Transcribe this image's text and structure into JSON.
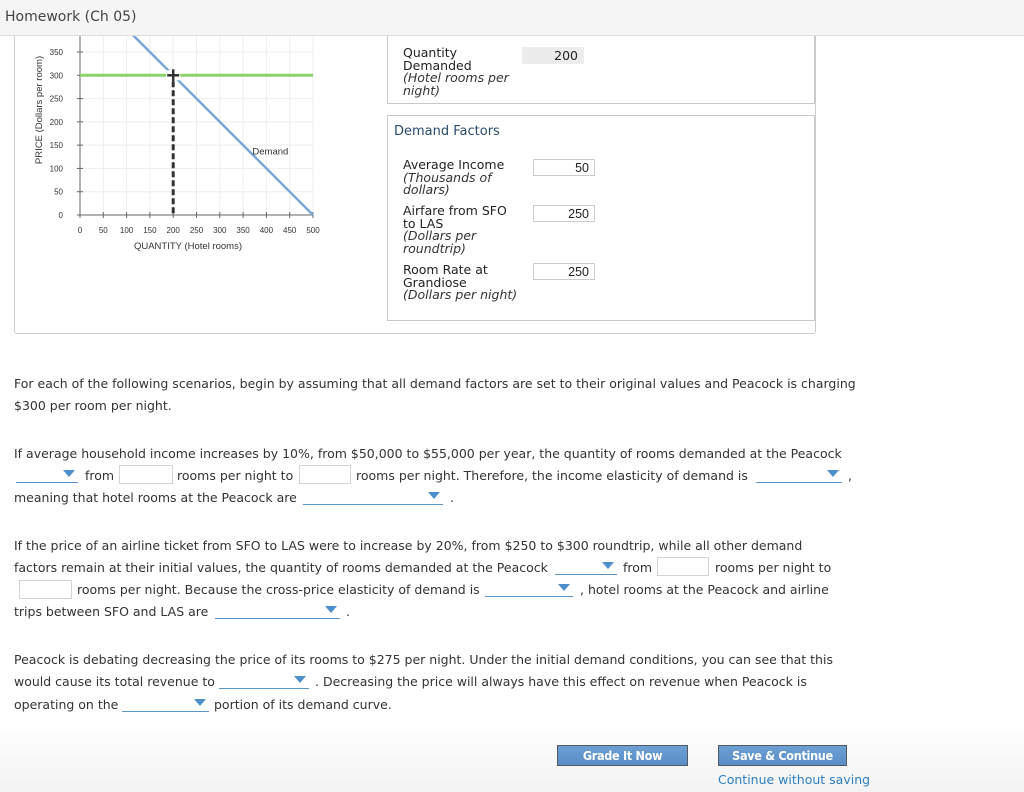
{
  "header": {
    "title": "Homework (Ch 05)"
  },
  "chart_data": {
    "type": "line",
    "title": "",
    "xlabel": "QUANTITY (Hotel rooms)",
    "ylabel": "PRICE (Dollars per room)",
    "xlim": [
      0,
      500
    ],
    "ylim": [
      0,
      350
    ],
    "x_ticks": [
      0,
      50,
      100,
      150,
      200,
      250,
      300,
      350,
      400,
      450,
      500
    ],
    "y_ticks": [
      0,
      50,
      100,
      150,
      200,
      250,
      300,
      350
    ],
    "grid": true,
    "series": [
      {
        "name": "Demand",
        "color": "#7ba7d6",
        "points": [
          [
            0,
            500
          ],
          [
            500,
            0
          ]
        ],
        "label": "Demand"
      },
      {
        "name": "Price",
        "color": "#88d46a",
        "points": [
          [
            0,
            300
          ],
          [
            500,
            300
          ]
        ]
      }
    ],
    "marker": {
      "name": "crosshair",
      "x": 200,
      "y": 300,
      "color": "#333333"
    },
    "dropline": {
      "x": 200,
      "from_y": 0,
      "to_y": 300,
      "style": "dashed"
    }
  },
  "quantity_box": {
    "label": "Quantity Demanded",
    "unit": "(Hotel rooms per night)",
    "value": "200"
  },
  "demand_factors": {
    "title": "Demand Factors",
    "items": [
      {
        "label": "Average Income",
        "unit": "(Thousands of dollars)",
        "value": "50"
      },
      {
        "label": "Airfare from SFO to LAS",
        "unit": "(Dollars per roundtrip)",
        "value": "250"
      },
      {
        "label": "Room Rate at Grandiose",
        "unit": "(Dollars per night)",
        "value": "250"
      }
    ]
  },
  "intro": {
    "line1": "For each of the following scenarios, begin by assuming that all demand factors are set to their original values and Peacock is charging",
    "line2": "$300 per room per night."
  },
  "q1": {
    "line1": "If average household income increases by 10%, from $50,000 to $55,000 per year, the quantity of rooms demanded at the Peacock",
    "from": "from",
    "mid": "rooms per night to",
    "after": "rooms per night. Therefore, the income elasticity of demand is",
    "comma": ",",
    "line3": "meaning that hotel rooms at the Peacock are",
    "period": "."
  },
  "q2": {
    "line1": "If the price of an airline ticket from SFO to LAS were to increase by 20%, from $250 to $300 roundtrip, while all other demand",
    "line2a": "factors remain at their initial values, the quantity of rooms demanded at the Peacock",
    "from": "from",
    "line2b": "rooms per night to",
    "line3a": "rooms per night. Because the cross-price elasticity of demand is",
    "line3b": ", hotel rooms at the Peacock and airline",
    "line4": "trips between SFO and LAS are",
    "period": "."
  },
  "q3": {
    "line1": "Peacock is debating decreasing the price of its rooms to $275 per night. Under the initial demand conditions, you can see that this",
    "line2a": "would cause its total revenue to",
    "line2b": ". Decreasing the price will always have this effect on revenue when Peacock is",
    "line3a": "operating on the",
    "line3b": "portion of its demand curve."
  },
  "footer": {
    "grade_button": "Grade It Now",
    "save_button": "Save & Continue",
    "continue_link": "Continue without saving"
  }
}
